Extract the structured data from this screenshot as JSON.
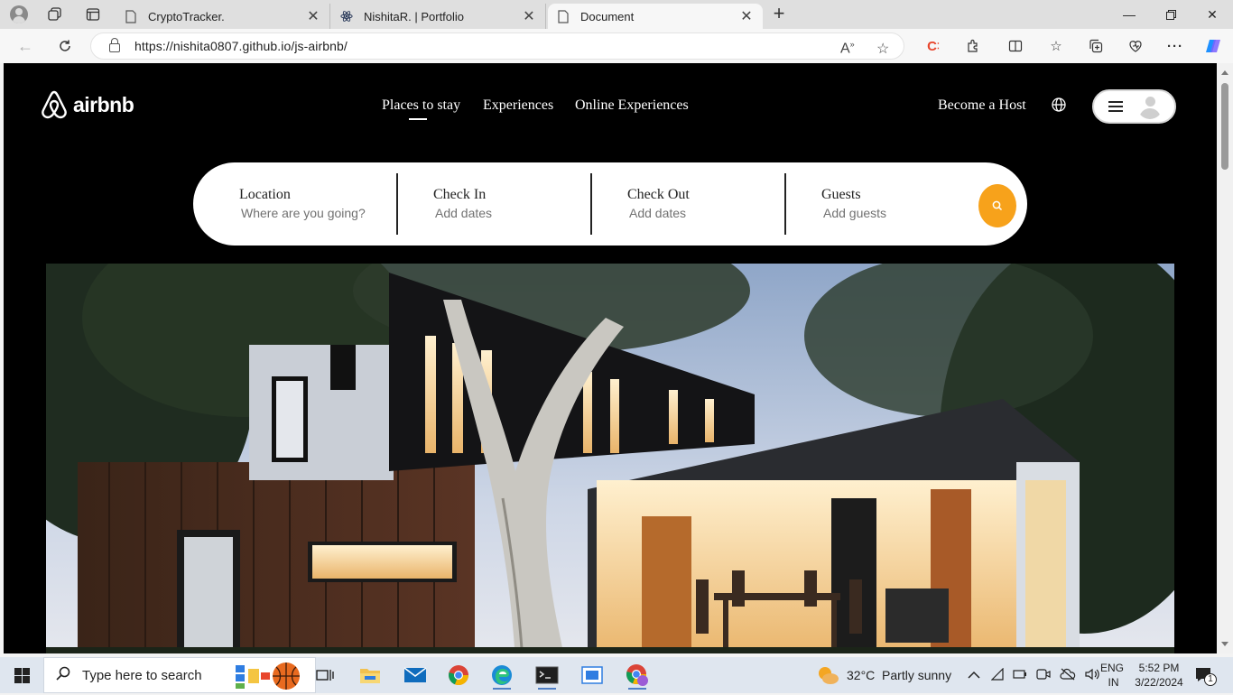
{
  "browser": {
    "tabs": [
      {
        "title": "CryptoTracker.",
        "icon": "page-icon"
      },
      {
        "title": "NishitaR. | Portfolio",
        "icon": "react-icon"
      },
      {
        "title": "Document",
        "icon": "page-icon",
        "active": true
      }
    ],
    "url": "https://nishita0807.github.io/js-airbnb/"
  },
  "site": {
    "logo_text": "airbnb",
    "nav": {
      "places": "Places to stay",
      "experiences": "Experiences",
      "online": "Online Experiences"
    },
    "become_host": "Become a Host",
    "search": {
      "location_label": "Location",
      "location_placeholder": "Where are you going?",
      "checkin_label": "Check In",
      "checkin_placeholder": "Add dates",
      "checkout_label": "Check Out",
      "checkout_placeholder": "Add dates",
      "guests_label": "Guests",
      "guests_placeholder": "Add guests"
    },
    "colors": {
      "background": "#000000",
      "accent": "#f7a21b"
    }
  },
  "taskbar": {
    "search_placeholder": "Type here to search",
    "weather": "32°C  Partly sunny",
    "lang_top": "ENG",
    "lang_bottom": "IN",
    "time": "5:52 PM",
    "date": "3/22/2024",
    "notification_count": "1"
  }
}
